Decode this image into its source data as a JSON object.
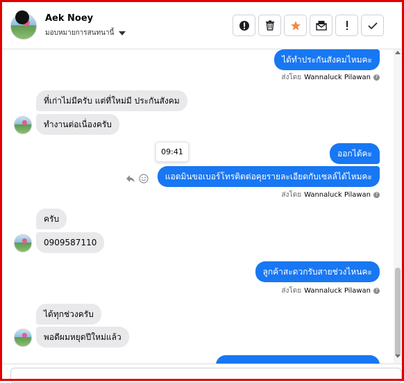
{
  "header": {
    "contact_name": "Aek Noey",
    "assign_label": "มอบหมายการสนทนานี้"
  },
  "toolbar": {
    "buttons": [
      {
        "icon": "alert-circle-icon"
      },
      {
        "icon": "trash-icon"
      },
      {
        "icon": "star-icon",
        "color": "#f5883b"
      },
      {
        "icon": "mail-icon"
      },
      {
        "icon": "exclamation-icon"
      },
      {
        "icon": "check-icon"
      }
    ]
  },
  "messages": [
    {
      "side": "out",
      "text": "ได้ทำประกันสังคมไหมคะ"
    },
    {
      "side": "in",
      "text": "ที่เก่าไม่มีครับ แต่ที่ใหม่มี ประกันสังคม"
    },
    {
      "side": "in",
      "text": "ทำงานต่อเนื่องครับ"
    },
    {
      "side": "out",
      "text": "ออกได้คะ"
    },
    {
      "side": "out",
      "text": "แอดมินขอเบอร์โทรติดต่อคุยรายละเอียดกับเซลล์ได้ไหมคะ"
    },
    {
      "side": "in",
      "text": "ครับ"
    },
    {
      "side": "in",
      "text": "0909587110"
    },
    {
      "side": "out",
      "text": "ลูกค้าสะดวกรับสายช่วงไหนคะ"
    },
    {
      "side": "in",
      "text": "ได้ทุกช่วงครับ"
    },
    {
      "side": "in",
      "text": "พอดีผมหยุดปีใหม่แล้ว"
    }
  ],
  "sent_by": {
    "prefix": "ส่งโดย",
    "agent": "Wannaluck Pilawan"
  },
  "tooltip_time": "09:41",
  "accent_color": "#1877f2"
}
